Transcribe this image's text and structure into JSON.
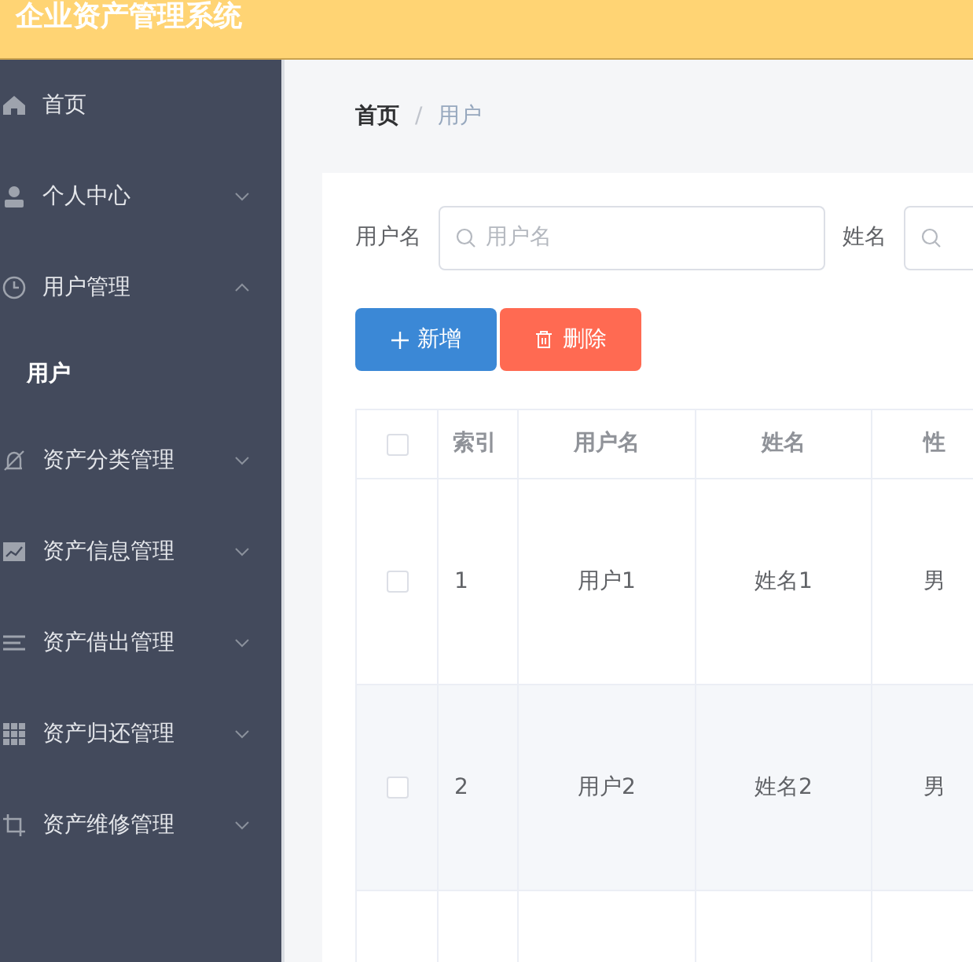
{
  "header": {
    "title": "企业资产管理系统"
  },
  "sidebar": {
    "items": [
      {
        "label": "首页",
        "kind": "home",
        "selected": false
      },
      {
        "label": "个人中心",
        "kind": "person",
        "expanded": false,
        "selected": false
      },
      {
        "label": "用户管理",
        "kind": "clock",
        "expanded": true,
        "selected": false,
        "children": [
          {
            "label": "用户",
            "selected": true
          }
        ]
      },
      {
        "label": "资产分类管理",
        "kind": "bell",
        "expanded": false,
        "selected": false
      },
      {
        "label": "资产信息管理",
        "kind": "chart",
        "expanded": false,
        "selected": false
      },
      {
        "label": "资产借出管理",
        "kind": "lines",
        "expanded": false,
        "selected": false
      },
      {
        "label": "资产归还管理",
        "kind": "grid",
        "expanded": false,
        "selected": false
      },
      {
        "label": "资产维修管理",
        "kind": "crop",
        "expanded": false,
        "selected": false
      }
    ]
  },
  "breadcrumb": {
    "separator": "/",
    "items": [
      "首页",
      "用户"
    ]
  },
  "filters": [
    {
      "label": "用户名",
      "placeholder": "用户名"
    },
    {
      "label": "姓名"
    }
  ],
  "buttons": [
    {
      "label": "新增",
      "kind": "add"
    },
    {
      "label": "删除",
      "kind": "delete"
    }
  ],
  "table": {
    "header_checked": false,
    "columns": [
      "索引",
      "用户名",
      "姓名",
      "性"
    ],
    "rows": [
      {
        "checked": false,
        "cells": [
          "1",
          "用户1",
          "姓名1",
          "男"
        ]
      },
      {
        "checked": false,
        "cells": [
          "2",
          "用户2",
          "姓名2",
          "男"
        ]
      }
    ]
  }
}
